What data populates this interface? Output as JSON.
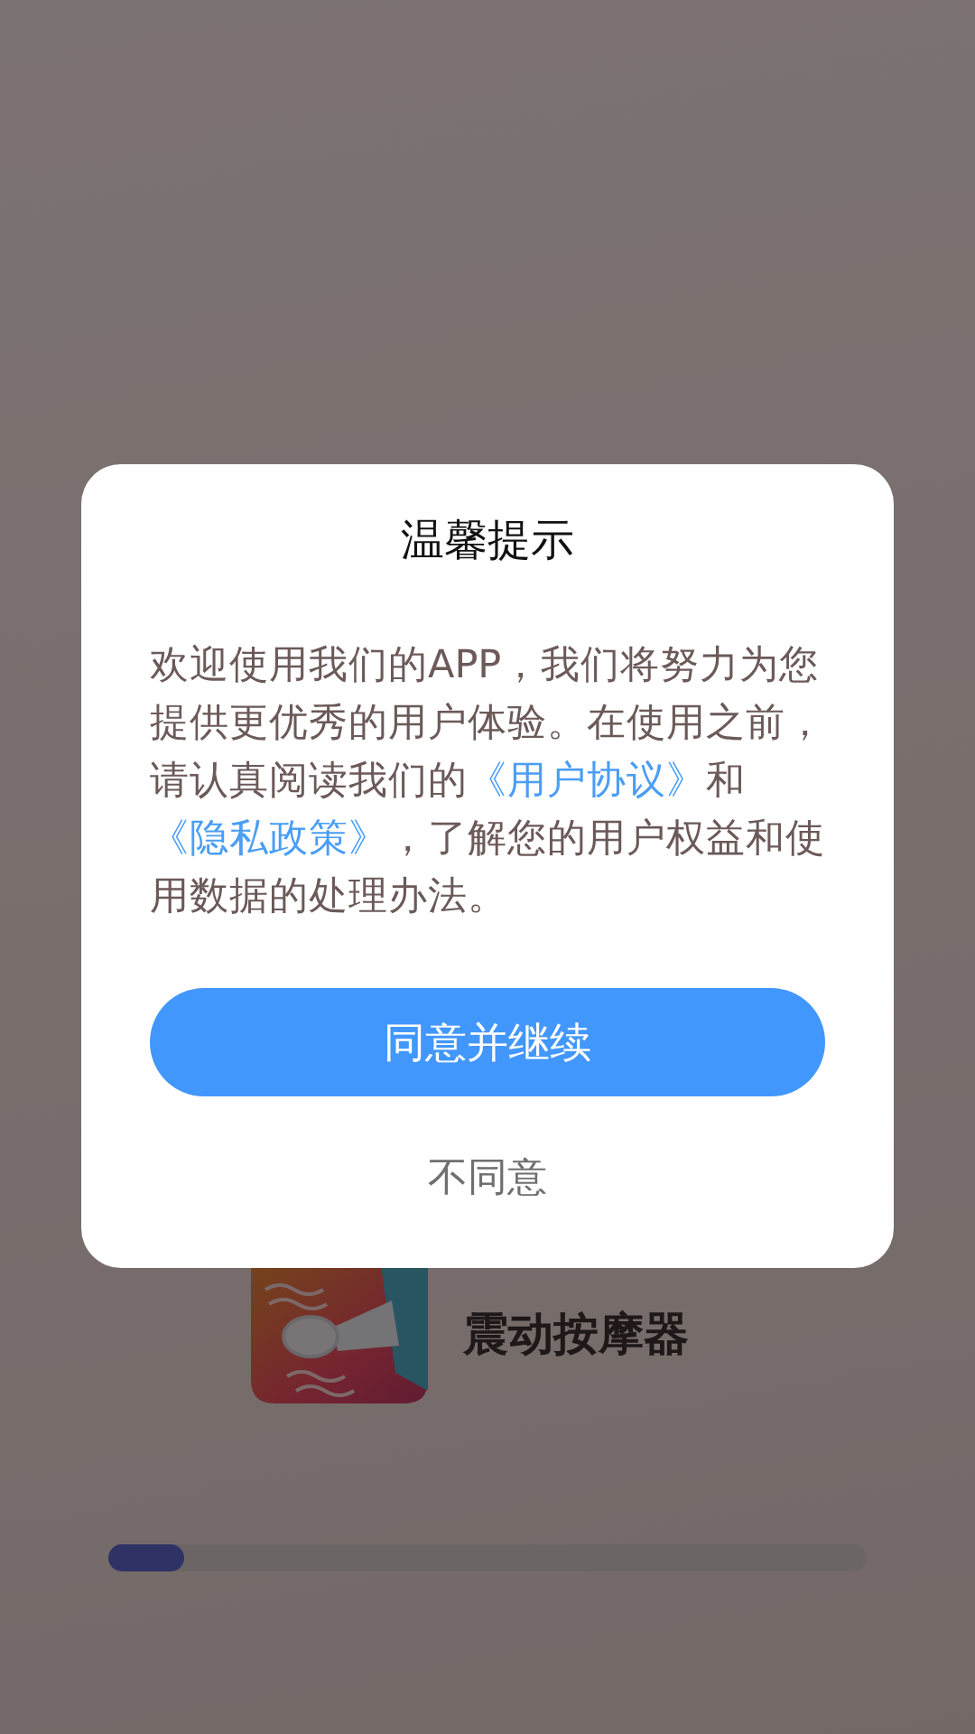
{
  "splash": {
    "app_name": "震动按摩器",
    "progress": {
      "level": 0.1
    }
  },
  "dialog": {
    "title": "温馨提示",
    "message": [
      {
        "kind": "text",
        "text": "欢迎使用我们的APP，我们将努力为您提供更优秀的用户体验。在使用之前，请认真阅读我们的"
      },
      {
        "kind": "link",
        "text": "《用户协议》"
      },
      {
        "kind": "text",
        "text": "和"
      },
      {
        "kind": "link",
        "text": "《隐私政策》"
      },
      {
        "kind": "text",
        "text": "，了解您的用户权益和使用数据的处理办法。"
      }
    ],
    "agree_button": "同意并继续",
    "decline_button": "不同意"
  }
}
